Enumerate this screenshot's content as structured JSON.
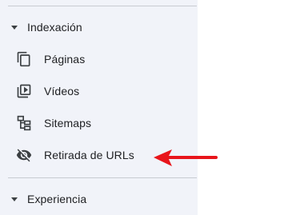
{
  "sidebar": {
    "sections": [
      {
        "label": "Indexación",
        "expanded": true,
        "icon": "caret-down-icon",
        "items": [
          {
            "label": "Páginas",
            "icon": "pages-icon"
          },
          {
            "label": "Vídeos",
            "icon": "video-icon"
          },
          {
            "label": "Sitemaps",
            "icon": "sitemap-icon"
          },
          {
            "label": "Retirada de URLs",
            "icon": "visibility-off-icon"
          }
        ]
      },
      {
        "label": "Experiencia",
        "expanded": true,
        "icon": "caret-down-icon",
        "items": []
      }
    ]
  },
  "colors": {
    "sidebar_background": "#f1f3f9",
    "text": "#202124",
    "icon": "#3c4043",
    "divider": "#c8cbd1",
    "annotation_arrow": "#e8151b"
  }
}
